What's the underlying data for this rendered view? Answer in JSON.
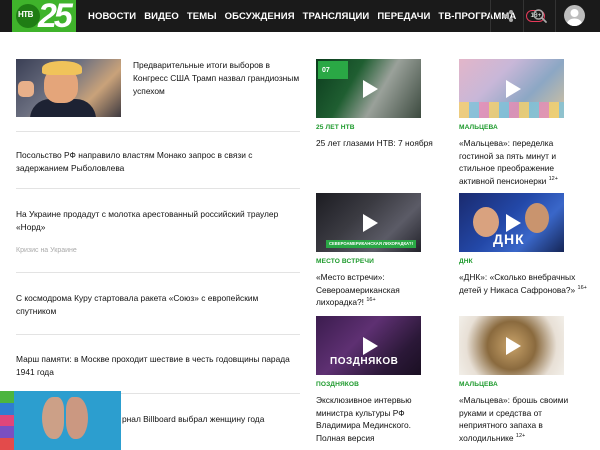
{
  "header": {
    "logo_text": "НТВ",
    "logo_anniversary": "25",
    "nav": [
      "НОВОСТИ",
      "ВИДЕО",
      "ТЕМЫ",
      "ОБСУЖДЕНИЯ",
      "ТРАНСЛЯЦИИ",
      "ПЕРЕДАЧИ",
      "ТВ-ПРОГРАММА"
    ],
    "age_badge": "18+",
    "icons": [
      "share-icon",
      "search-icon",
      "user-avatar-icon"
    ],
    "colors": {
      "bar": "#1a1a1a",
      "brand_green": "#3fb32b",
      "badge_border": "#e63a5a"
    }
  },
  "news": {
    "lead": "Предварительные итоги выборов в Конгресс США Трамп назвал грандиозным успехом",
    "items": [
      "Посольство РФ направило властям Монако запрос в связи с задержанием Рыболовлева",
      "На Украине продадут с молотка арестованный российский траулер «Норд»",
      "С космодрома Куру стартовала ракета «Союз» с европейским спутником",
      "Марш памяти: в Москве проходит шествие в честь годовщины парада 1941 года",
      "рнал Billboard выбрал женщину года"
    ],
    "story_tag": "Кризис на Украине"
  },
  "cards": [
    {
      "tag": "25 лет НТВ",
      "title": "25 лет глазами НТВ: 7 ноября",
      "age": ""
    },
    {
      "tag": "Мальцева",
      "title": "«Мальцева»: переделка гостиной за пять минут и стильное преображение активной пенсионерки",
      "age": "12+"
    },
    {
      "tag": "Место встречи",
      "title": "«Место встречи»: Североамериканская лихорадка?!",
      "age": "16+"
    },
    {
      "tag": "ДНК",
      "title": "«ДНК»: «Сколько внебрачных детей у Никаса Сафронова?»",
      "age": "16+"
    },
    {
      "tag": "Поздняков",
      "title": "Эксклюзивное интервью министра культуры РФ Владимира Мединского. Полная версия",
      "age": ""
    },
    {
      "tag": "Мальцева",
      "title": "«Мальцева»: брошь своими руками и средства от неприятного запаха в холодильнике",
      "age": "12+"
    }
  ],
  "thumb_text": {
    "card1": "07",
    "card3_overlay": "СЕВЕРОАМЕРИКАНСКАЯ ЛИХОРАДКА?!",
    "card4_overlay": "ДНК",
    "card5_overlay": "ПОЗДНЯКОВ"
  },
  "accent_color": "#1d9a2c"
}
